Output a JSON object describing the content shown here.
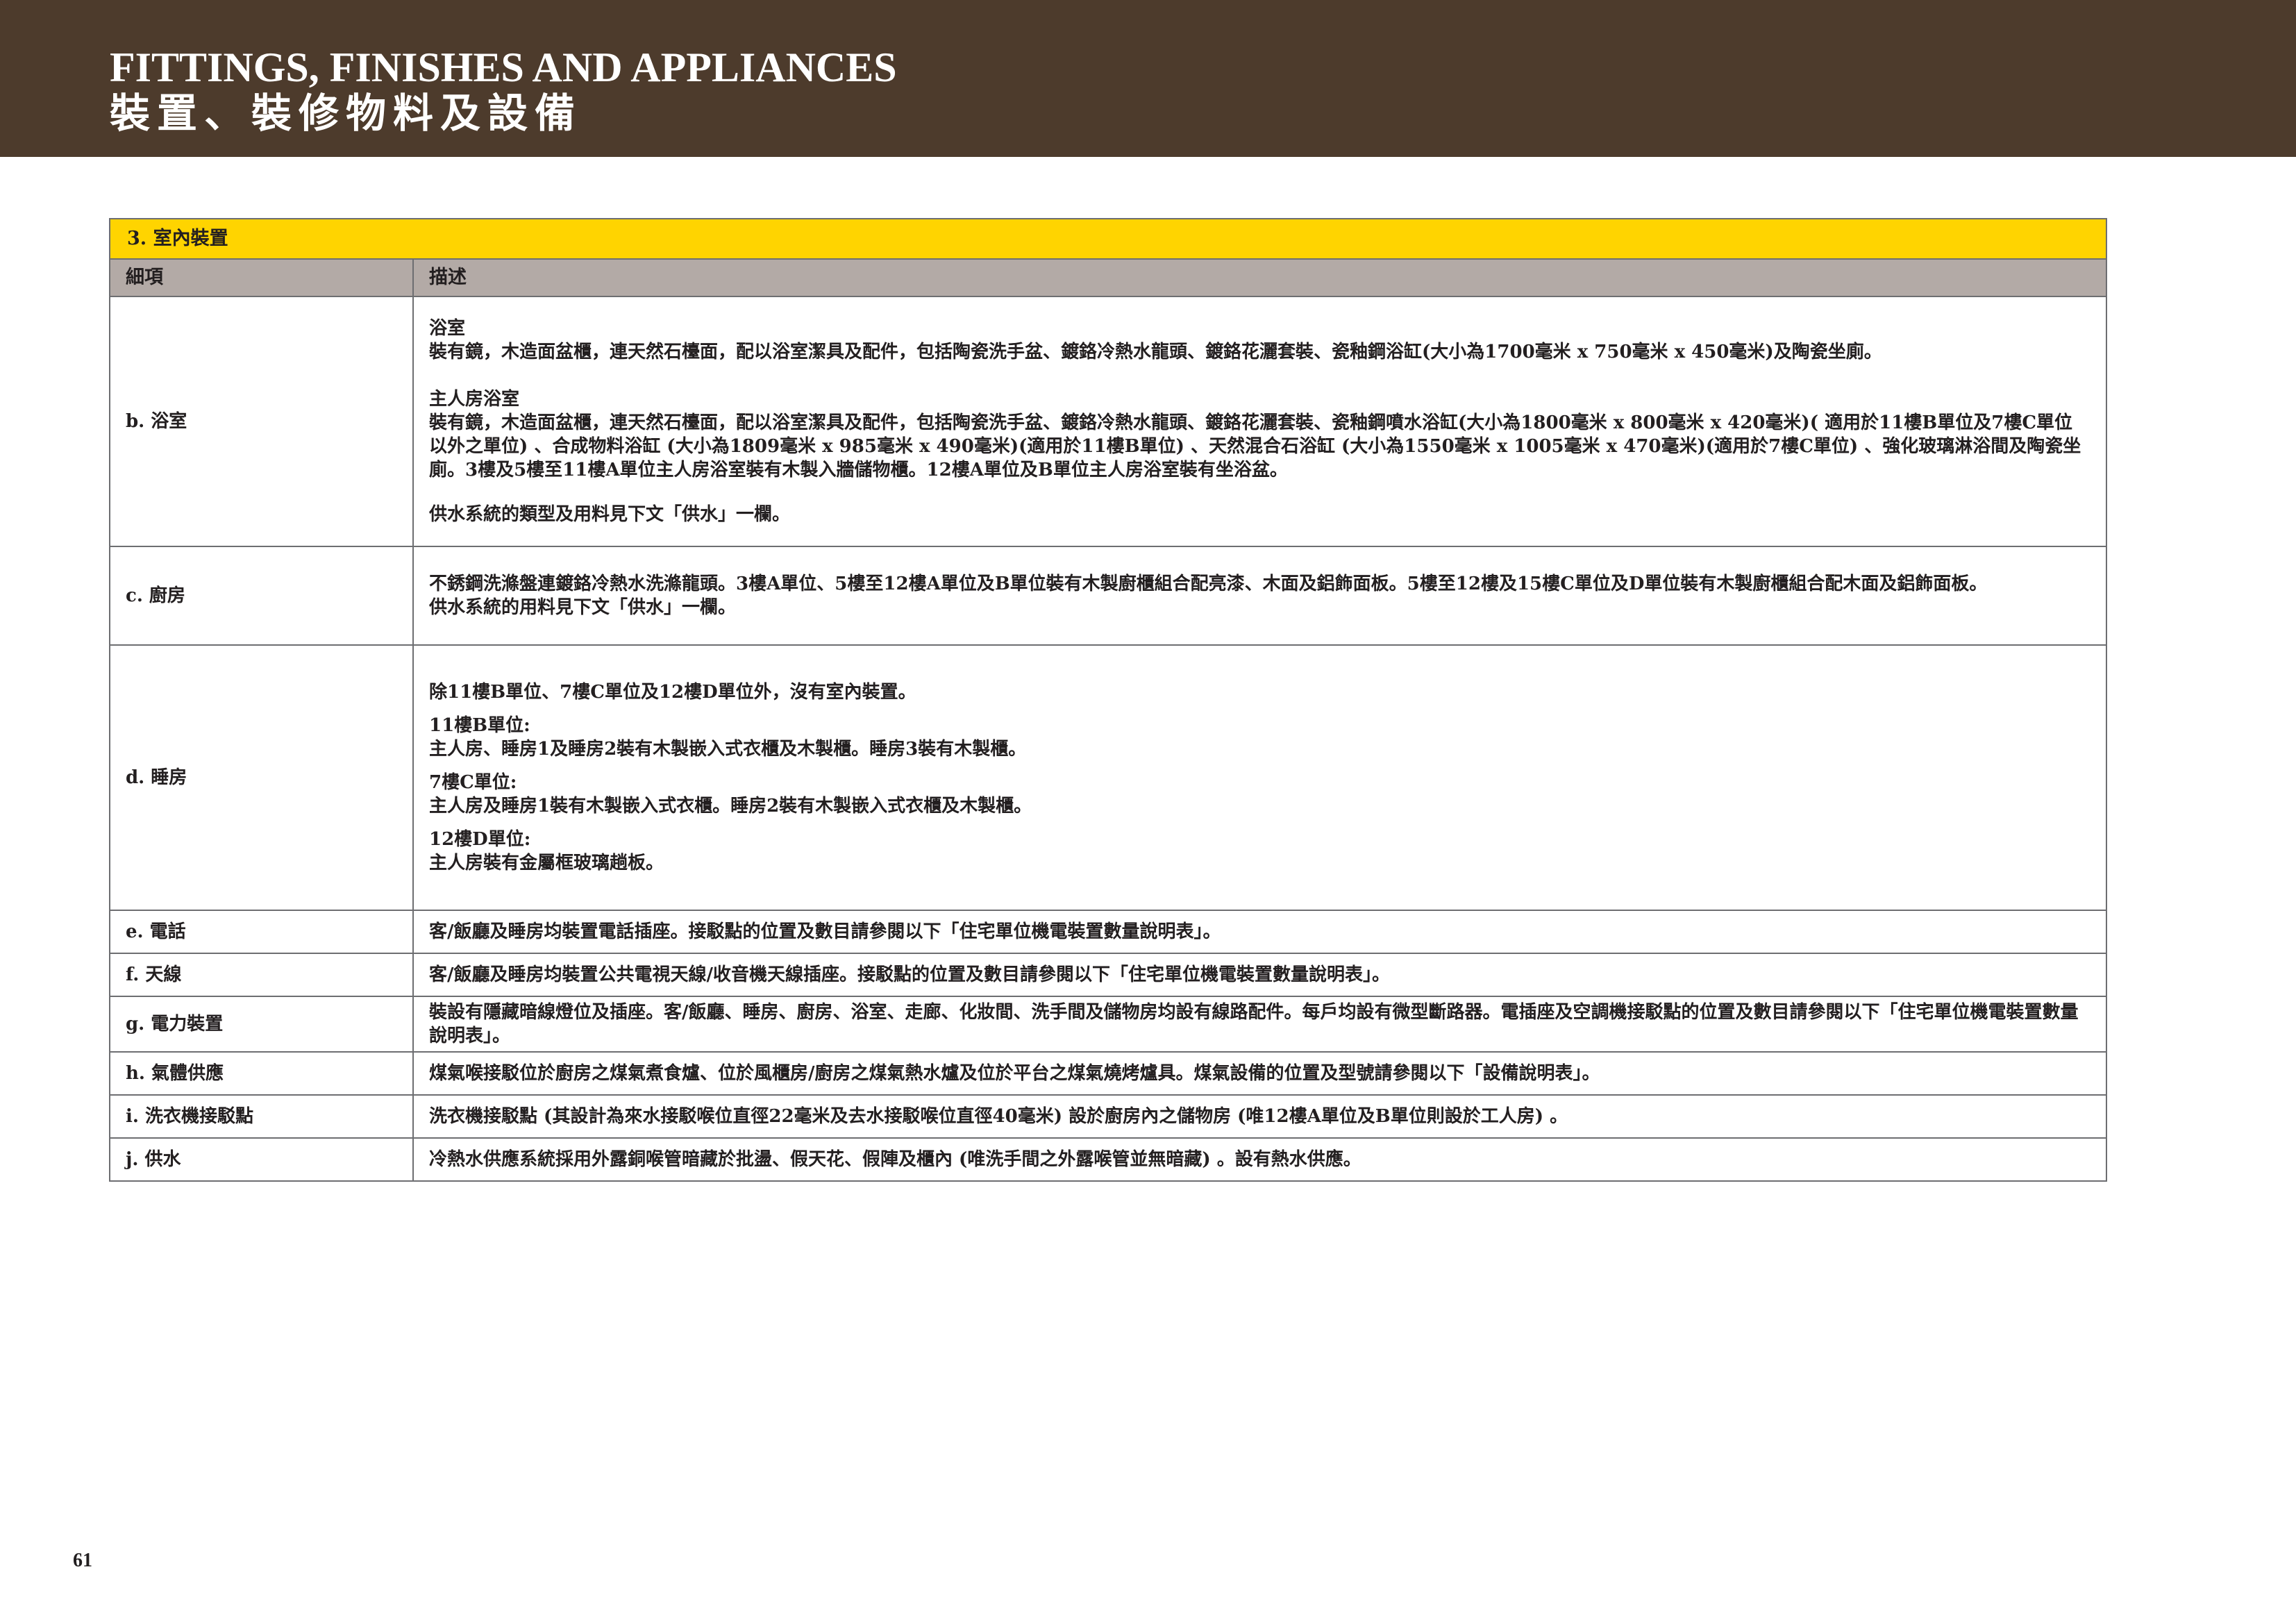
{
  "header": {
    "title_en": "FITTINGS, FINISHES AND APPLIANCES",
    "title_zh": "裝置、裝修物料及設備"
  },
  "table": {
    "section_title": "3. 室內裝置",
    "col_item": "細項",
    "col_desc": "描述",
    "bathroom": {
      "item": "b. 浴室",
      "p1_title": "浴室",
      "p1_body": "裝有鏡，木造面盆櫃，連天然石檯面，配以浴室潔具及配件，包括陶瓷洗手盆、鍍鉻冷熱水龍頭、鍍鉻花灑套裝、瓷釉鋼浴缸(大小為1700毫米 x 750毫米 x 450毫米)及陶瓷坐廁。",
      "p2_title": "主人房浴室",
      "p2_body": "裝有鏡，木造面盆櫃，連天然石檯面，配以浴室潔具及配件，包括陶瓷洗手盆、鍍鉻冷熱水龍頭、鍍鉻花灑套裝、瓷釉鋼噴水浴缸(大小為1800毫米 x 800毫米 x 420毫米)( 適用於11樓B單位及7樓C單位以外之單位) 、合成物料浴缸 (大小為1809毫米 x 985毫米 x 490毫米)(適用於11樓B單位) 、天然混合石浴缸 (大小為1550毫米 x 1005毫米 x 470毫米)(適用於7樓C單位) 、強化玻璃淋浴間及陶瓷坐廁。3樓及5樓至11樓A單位主人房浴室裝有木製入牆儲物櫃。12樓A單位及B單位主人房浴室裝有坐浴盆。",
      "p3": "供水系統的類型及用料見下文「供水」一欄。"
    },
    "kitchen": {
      "item": "c. 廚房",
      "p1": "不銹鋼洗滌盤連鍍鉻冷熱水洗滌龍頭。3樓A單位、5樓至12樓A單位及B單位裝有木製廚櫃組合配亮漆、木面及鋁飾面板。5樓至12樓及15樓C單位及D單位裝有木製廚櫃組合配木面及鋁飾面板。",
      "p2": "供水系統的用料見下文「供水」一欄。"
    },
    "bedroom": {
      "item": "d. 睡房",
      "p1": "除11樓B單位、7樓C單位及12樓D單位外，沒有室內裝置。",
      "p2_title": "11樓B單位:",
      "p2_body": "主人房、睡房1及睡房2裝有木製嵌入式衣櫃及木製櫃。睡房3裝有木製櫃。",
      "p3_title": "7樓C單位:",
      "p3_body": "主人房及睡房1裝有木製嵌入式衣櫃。睡房2裝有木製嵌入式衣櫃及木製櫃。",
      "p4_title": "12樓D單位:",
      "p4_body": "主人房裝有金屬框玻璃趟板。"
    },
    "telephone": {
      "item": "e. 電話",
      "desc": "客/飯廳及睡房均裝置電話插座。接駁點的位置及數目請參閱以下「住宅單位機電裝置數量說明表」。"
    },
    "antenna": {
      "item": "f. 天線",
      "desc": "客/飯廳及睡房均裝置公共電視天線/收音機天線插座。接駁點的位置及數目請參閱以下「住宅單位機電裝置數量說明表」。"
    },
    "electrical": {
      "item": "g. 電力裝置",
      "desc": "裝設有隱藏暗線燈位及插座。客/飯廳、睡房、廚房、浴室、走廊、化妝間、洗手間及儲物房均設有線路配件。每戶均設有微型斷路器。電插座及空調機接駁點的位置及數目請參閱以下「住宅單位機電裝置數量說明表」。"
    },
    "gas": {
      "item": "h. 氣體供應",
      "desc": "煤氣喉接駁位於廚房之煤氣煮食爐、位於風櫃房/廚房之煤氣熱水爐及位於平台之煤氣燒烤爐具。煤氣設備的位置及型號請參閱以下「設備說明表」。"
    },
    "washer": {
      "item": "i. 洗衣機接駁點",
      "desc": "洗衣機接駁點 (其設計為來水接駁喉位直徑22毫米及去水接駁喉位直徑40毫米) 設於廚房內之儲物房 (唯12樓A單位及B單位則設於工人房) 。"
    },
    "water": {
      "item": "j. 供水",
      "desc": "冷熱水供應系統採用外露銅喉管暗藏於批盪、假天花、假陣及櫃內 (唯洗手間之外露喉管並無暗藏) 。設有熱水供應。"
    }
  },
  "footer": {
    "page_number": "61"
  }
}
